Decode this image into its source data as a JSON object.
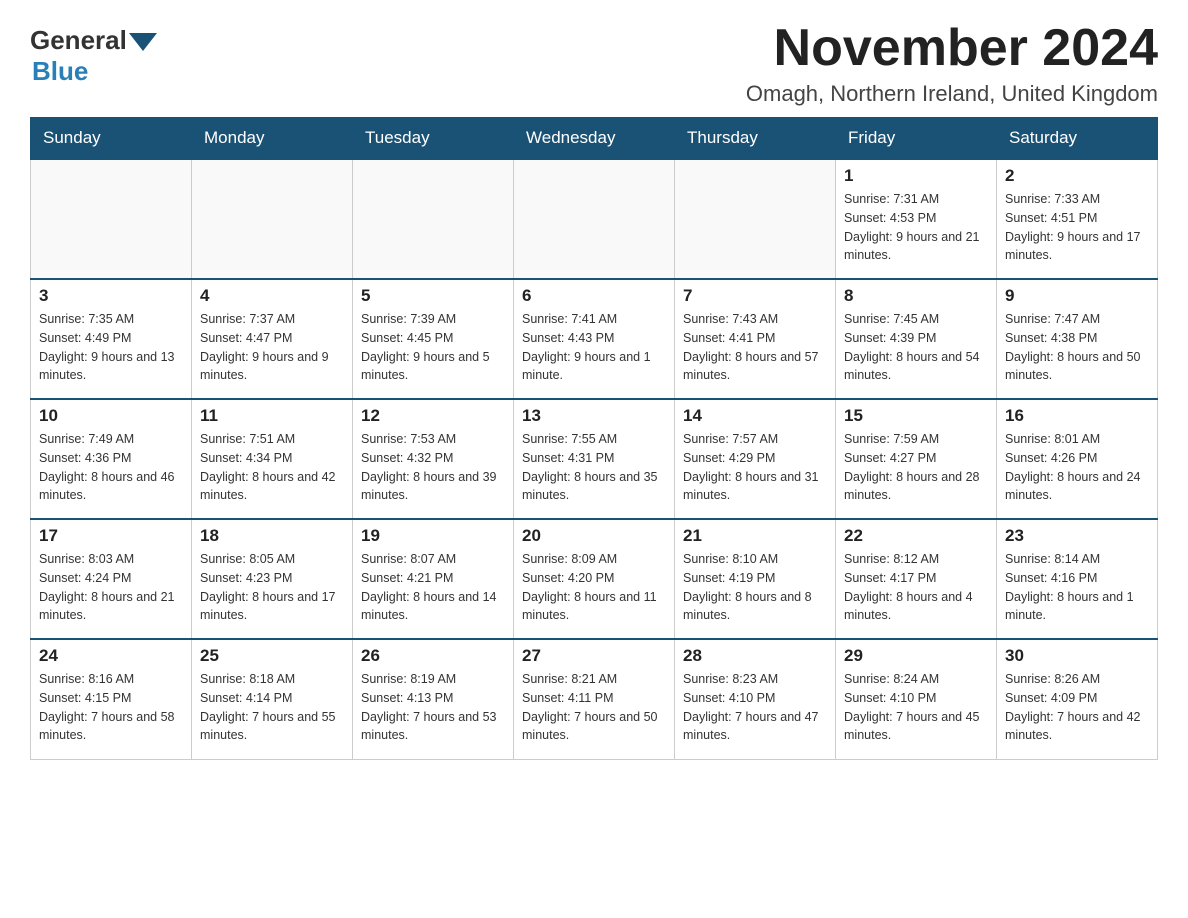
{
  "logo": {
    "general": "General",
    "blue": "Blue"
  },
  "title": {
    "month": "November 2024",
    "location": "Omagh, Northern Ireland, United Kingdom"
  },
  "headers": [
    "Sunday",
    "Monday",
    "Tuesday",
    "Wednesday",
    "Thursday",
    "Friday",
    "Saturday"
  ],
  "weeks": [
    [
      {
        "day": "",
        "info": ""
      },
      {
        "day": "",
        "info": ""
      },
      {
        "day": "",
        "info": ""
      },
      {
        "day": "",
        "info": ""
      },
      {
        "day": "",
        "info": ""
      },
      {
        "day": "1",
        "info": "Sunrise: 7:31 AM\nSunset: 4:53 PM\nDaylight: 9 hours and 21 minutes."
      },
      {
        "day": "2",
        "info": "Sunrise: 7:33 AM\nSunset: 4:51 PM\nDaylight: 9 hours and 17 minutes."
      }
    ],
    [
      {
        "day": "3",
        "info": "Sunrise: 7:35 AM\nSunset: 4:49 PM\nDaylight: 9 hours and 13 minutes."
      },
      {
        "day": "4",
        "info": "Sunrise: 7:37 AM\nSunset: 4:47 PM\nDaylight: 9 hours and 9 minutes."
      },
      {
        "day": "5",
        "info": "Sunrise: 7:39 AM\nSunset: 4:45 PM\nDaylight: 9 hours and 5 minutes."
      },
      {
        "day": "6",
        "info": "Sunrise: 7:41 AM\nSunset: 4:43 PM\nDaylight: 9 hours and 1 minute."
      },
      {
        "day": "7",
        "info": "Sunrise: 7:43 AM\nSunset: 4:41 PM\nDaylight: 8 hours and 57 minutes."
      },
      {
        "day": "8",
        "info": "Sunrise: 7:45 AM\nSunset: 4:39 PM\nDaylight: 8 hours and 54 minutes."
      },
      {
        "day": "9",
        "info": "Sunrise: 7:47 AM\nSunset: 4:38 PM\nDaylight: 8 hours and 50 minutes."
      }
    ],
    [
      {
        "day": "10",
        "info": "Sunrise: 7:49 AM\nSunset: 4:36 PM\nDaylight: 8 hours and 46 minutes."
      },
      {
        "day": "11",
        "info": "Sunrise: 7:51 AM\nSunset: 4:34 PM\nDaylight: 8 hours and 42 minutes."
      },
      {
        "day": "12",
        "info": "Sunrise: 7:53 AM\nSunset: 4:32 PM\nDaylight: 8 hours and 39 minutes."
      },
      {
        "day": "13",
        "info": "Sunrise: 7:55 AM\nSunset: 4:31 PM\nDaylight: 8 hours and 35 minutes."
      },
      {
        "day": "14",
        "info": "Sunrise: 7:57 AM\nSunset: 4:29 PM\nDaylight: 8 hours and 31 minutes."
      },
      {
        "day": "15",
        "info": "Sunrise: 7:59 AM\nSunset: 4:27 PM\nDaylight: 8 hours and 28 minutes."
      },
      {
        "day": "16",
        "info": "Sunrise: 8:01 AM\nSunset: 4:26 PM\nDaylight: 8 hours and 24 minutes."
      }
    ],
    [
      {
        "day": "17",
        "info": "Sunrise: 8:03 AM\nSunset: 4:24 PM\nDaylight: 8 hours and 21 minutes."
      },
      {
        "day": "18",
        "info": "Sunrise: 8:05 AM\nSunset: 4:23 PM\nDaylight: 8 hours and 17 minutes."
      },
      {
        "day": "19",
        "info": "Sunrise: 8:07 AM\nSunset: 4:21 PM\nDaylight: 8 hours and 14 minutes."
      },
      {
        "day": "20",
        "info": "Sunrise: 8:09 AM\nSunset: 4:20 PM\nDaylight: 8 hours and 11 minutes."
      },
      {
        "day": "21",
        "info": "Sunrise: 8:10 AM\nSunset: 4:19 PM\nDaylight: 8 hours and 8 minutes."
      },
      {
        "day": "22",
        "info": "Sunrise: 8:12 AM\nSunset: 4:17 PM\nDaylight: 8 hours and 4 minutes."
      },
      {
        "day": "23",
        "info": "Sunrise: 8:14 AM\nSunset: 4:16 PM\nDaylight: 8 hours and 1 minute."
      }
    ],
    [
      {
        "day": "24",
        "info": "Sunrise: 8:16 AM\nSunset: 4:15 PM\nDaylight: 7 hours and 58 minutes."
      },
      {
        "day": "25",
        "info": "Sunrise: 8:18 AM\nSunset: 4:14 PM\nDaylight: 7 hours and 55 minutes."
      },
      {
        "day": "26",
        "info": "Sunrise: 8:19 AM\nSunset: 4:13 PM\nDaylight: 7 hours and 53 minutes."
      },
      {
        "day": "27",
        "info": "Sunrise: 8:21 AM\nSunset: 4:11 PM\nDaylight: 7 hours and 50 minutes."
      },
      {
        "day": "28",
        "info": "Sunrise: 8:23 AM\nSunset: 4:10 PM\nDaylight: 7 hours and 47 minutes."
      },
      {
        "day": "29",
        "info": "Sunrise: 8:24 AM\nSunset: 4:10 PM\nDaylight: 7 hours and 45 minutes."
      },
      {
        "day": "30",
        "info": "Sunrise: 8:26 AM\nSunset: 4:09 PM\nDaylight: 7 hours and 42 minutes."
      }
    ]
  ]
}
